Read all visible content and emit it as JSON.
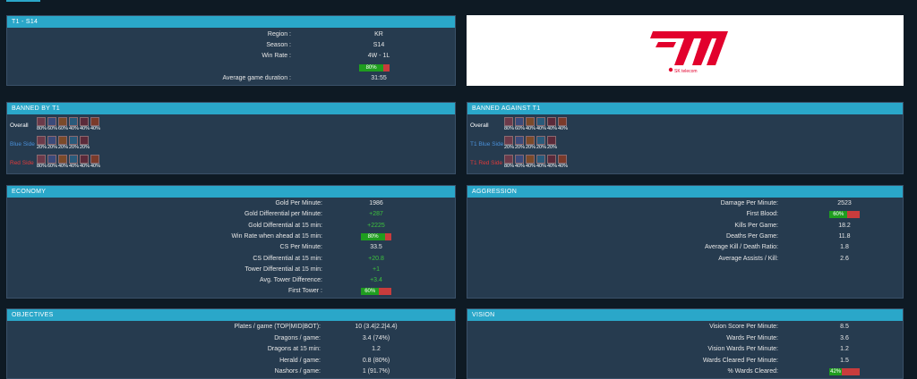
{
  "team_panel": {
    "title": "T1 - S14",
    "rows": [
      {
        "label": "Region :",
        "value": "KR"
      },
      {
        "label": "Season :",
        "value": "S14"
      },
      {
        "label": "Win Rate :",
        "value": "4W - 1L"
      }
    ],
    "winrate_bar": {
      "label": "80%",
      "fraction": 0.8
    },
    "duration": {
      "label": "Average game duration :",
      "value": "31:55"
    }
  },
  "logo": {
    "text": "SK telecom",
    "brand_color": "#e2012d"
  },
  "banned_by": {
    "title": "BANNED BY T1",
    "rows": [
      {
        "side": "Overall",
        "color": "#ffffff",
        "pcts": [
          "80%",
          "60%",
          "60%",
          "40%",
          "40%",
          "40%"
        ]
      },
      {
        "side": "Blue Side",
        "color": "#4a90d9",
        "pcts": [
          "20%",
          "20%",
          "20%",
          "20%",
          "20%"
        ]
      },
      {
        "side": "Red Side",
        "color": "#e03a3a",
        "pcts": [
          "80%",
          "60%",
          "40%",
          "40%",
          "40%",
          "40%"
        ]
      }
    ]
  },
  "banned_against": {
    "title": "BANNED AGAINST T1",
    "rows": [
      {
        "side": "Overall",
        "color": "#ffffff",
        "pcts": [
          "80%",
          "60%",
          "40%",
          "40%",
          "40%",
          "40%"
        ]
      },
      {
        "side": "T1 Blue Side",
        "color": "#4a90d9",
        "pcts": [
          "20%",
          "20%",
          "20%",
          "20%",
          "20%"
        ]
      },
      {
        "side": "T1 Red Side",
        "color": "#e03a3a",
        "pcts": [
          "80%",
          "40%",
          "40%",
          "40%",
          "40%",
          "40%"
        ]
      }
    ]
  },
  "economy": {
    "title": "ECONOMY",
    "rows": [
      {
        "label": "Gold Per Minute:",
        "value": "1986",
        "type": "text"
      },
      {
        "label": "Gold Differential per Minute:",
        "value": "+287",
        "type": "green"
      },
      {
        "label": "Gold Differential at 15 min:",
        "value": "+2225",
        "type": "green"
      },
      {
        "label": "Win Rate when ahead at 15 min:",
        "value": "80%",
        "type": "bar",
        "fraction": 0.8
      },
      {
        "label": "CS Per Minute:",
        "value": "33.5",
        "type": "text"
      },
      {
        "label": "CS Differential at 15 min:",
        "value": "+20.8",
        "type": "green"
      },
      {
        "label": "Tower Differential at 15 min:",
        "value": "+1",
        "type": "green"
      },
      {
        "label": "Avg. Tower Difference:",
        "value": "+3.4",
        "type": "green"
      },
      {
        "label": "First Tower :",
        "value": "60%",
        "type": "bar",
        "fraction": 0.6
      }
    ]
  },
  "aggression": {
    "title": "AGGRESSION",
    "rows": [
      {
        "label": "Damage Per Minute:",
        "value": "2523",
        "type": "text"
      },
      {
        "label": "First Blood:",
        "value": "60%",
        "type": "bar",
        "fraction": 0.6
      },
      {
        "label": "Kills Per Game:",
        "value": "18.2",
        "type": "text"
      },
      {
        "label": "Deaths Per Game:",
        "value": "11.8",
        "type": "text"
      },
      {
        "label": "Average Kill / Death Ratio:",
        "value": "1.8",
        "type": "text"
      },
      {
        "label": "Average Assists / Kill:",
        "value": "2.6",
        "type": "text"
      }
    ]
  },
  "objectives": {
    "title": "OBJECTIVES",
    "rows": [
      {
        "label": "Plates / game (TOP|MID|BOT):",
        "value": "10 (3.4|2.2|4.4)",
        "type": "text"
      },
      {
        "label": "Dragons / game:",
        "value": "3.4 (74%)",
        "type": "text"
      },
      {
        "label": "Dragons at 15 min:",
        "value": "1.2",
        "type": "text"
      },
      {
        "label": "Herald / game:",
        "value": "0.8 (80%)",
        "type": "text"
      },
      {
        "label": "Nashors / game:",
        "value": "1 (91.7%)",
        "type": "text"
      }
    ]
  },
  "vision": {
    "title": "VISION",
    "rows": [
      {
        "label": "Vision Score Per Minute:",
        "value": "8.5",
        "type": "text"
      },
      {
        "label": "Wards Per Minute:",
        "value": "3.6",
        "type": "text"
      },
      {
        "label": "Vision Wards Per Minute:",
        "value": "1.2",
        "type": "text"
      },
      {
        "label": "Wards Cleared Per Minute:",
        "value": "1.5",
        "type": "text"
      },
      {
        "label": "% Wards Cleared:",
        "value": "42%",
        "type": "bar",
        "fraction": 0.42
      }
    ]
  }
}
